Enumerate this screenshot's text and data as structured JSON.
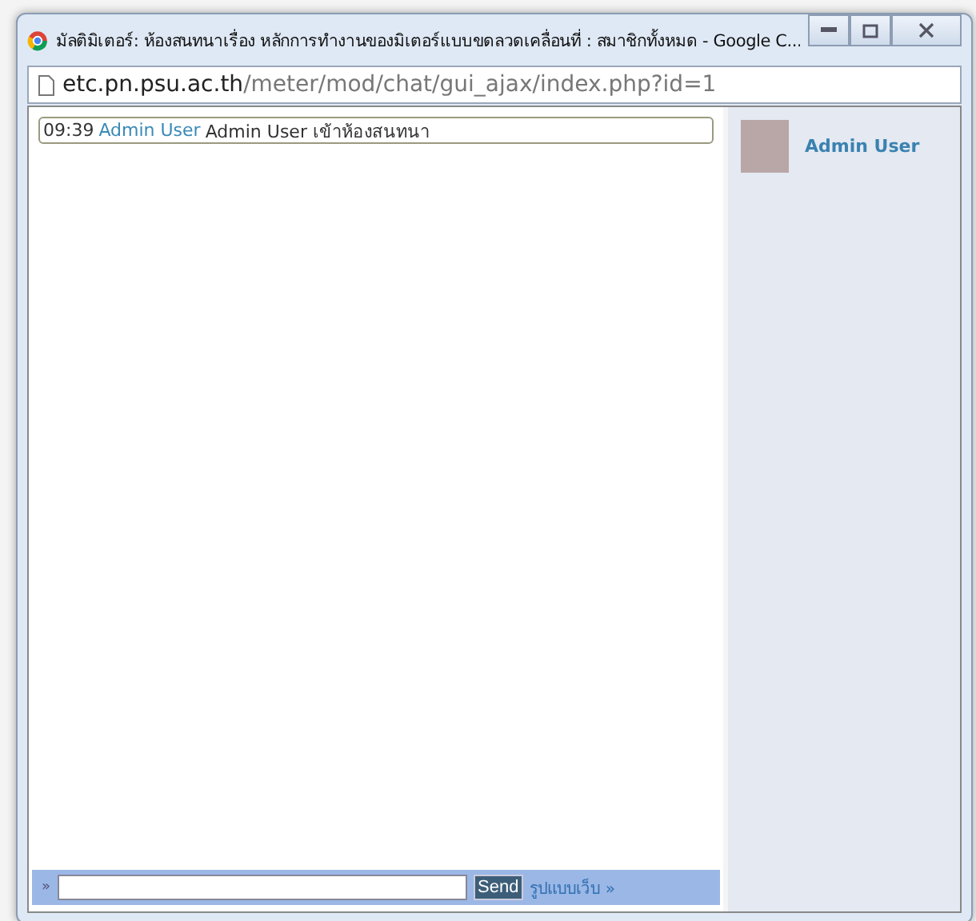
{
  "window": {
    "title": "มัลติมิเตอร์: ห้องสนทนาเรื่อง หลักการทำงานของมิเตอร์แบบขดลวดเคลื่อนที่ : สมาชิกทั้งหมด - Google C..."
  },
  "address_bar": {
    "host": "etc.pn.psu.ac.th",
    "path": "/meter/mod/chat/gui_ajax/index.php?id=1"
  },
  "messages": [
    {
      "time": "09:39",
      "user": "Admin User",
      "text": "Admin User เข้าห้องสนทนา"
    }
  ],
  "users": [
    {
      "name": "Admin User"
    }
  ],
  "input_bar": {
    "marker": "»",
    "send": "Send",
    "link": "รูปแบบเว็บ »"
  }
}
